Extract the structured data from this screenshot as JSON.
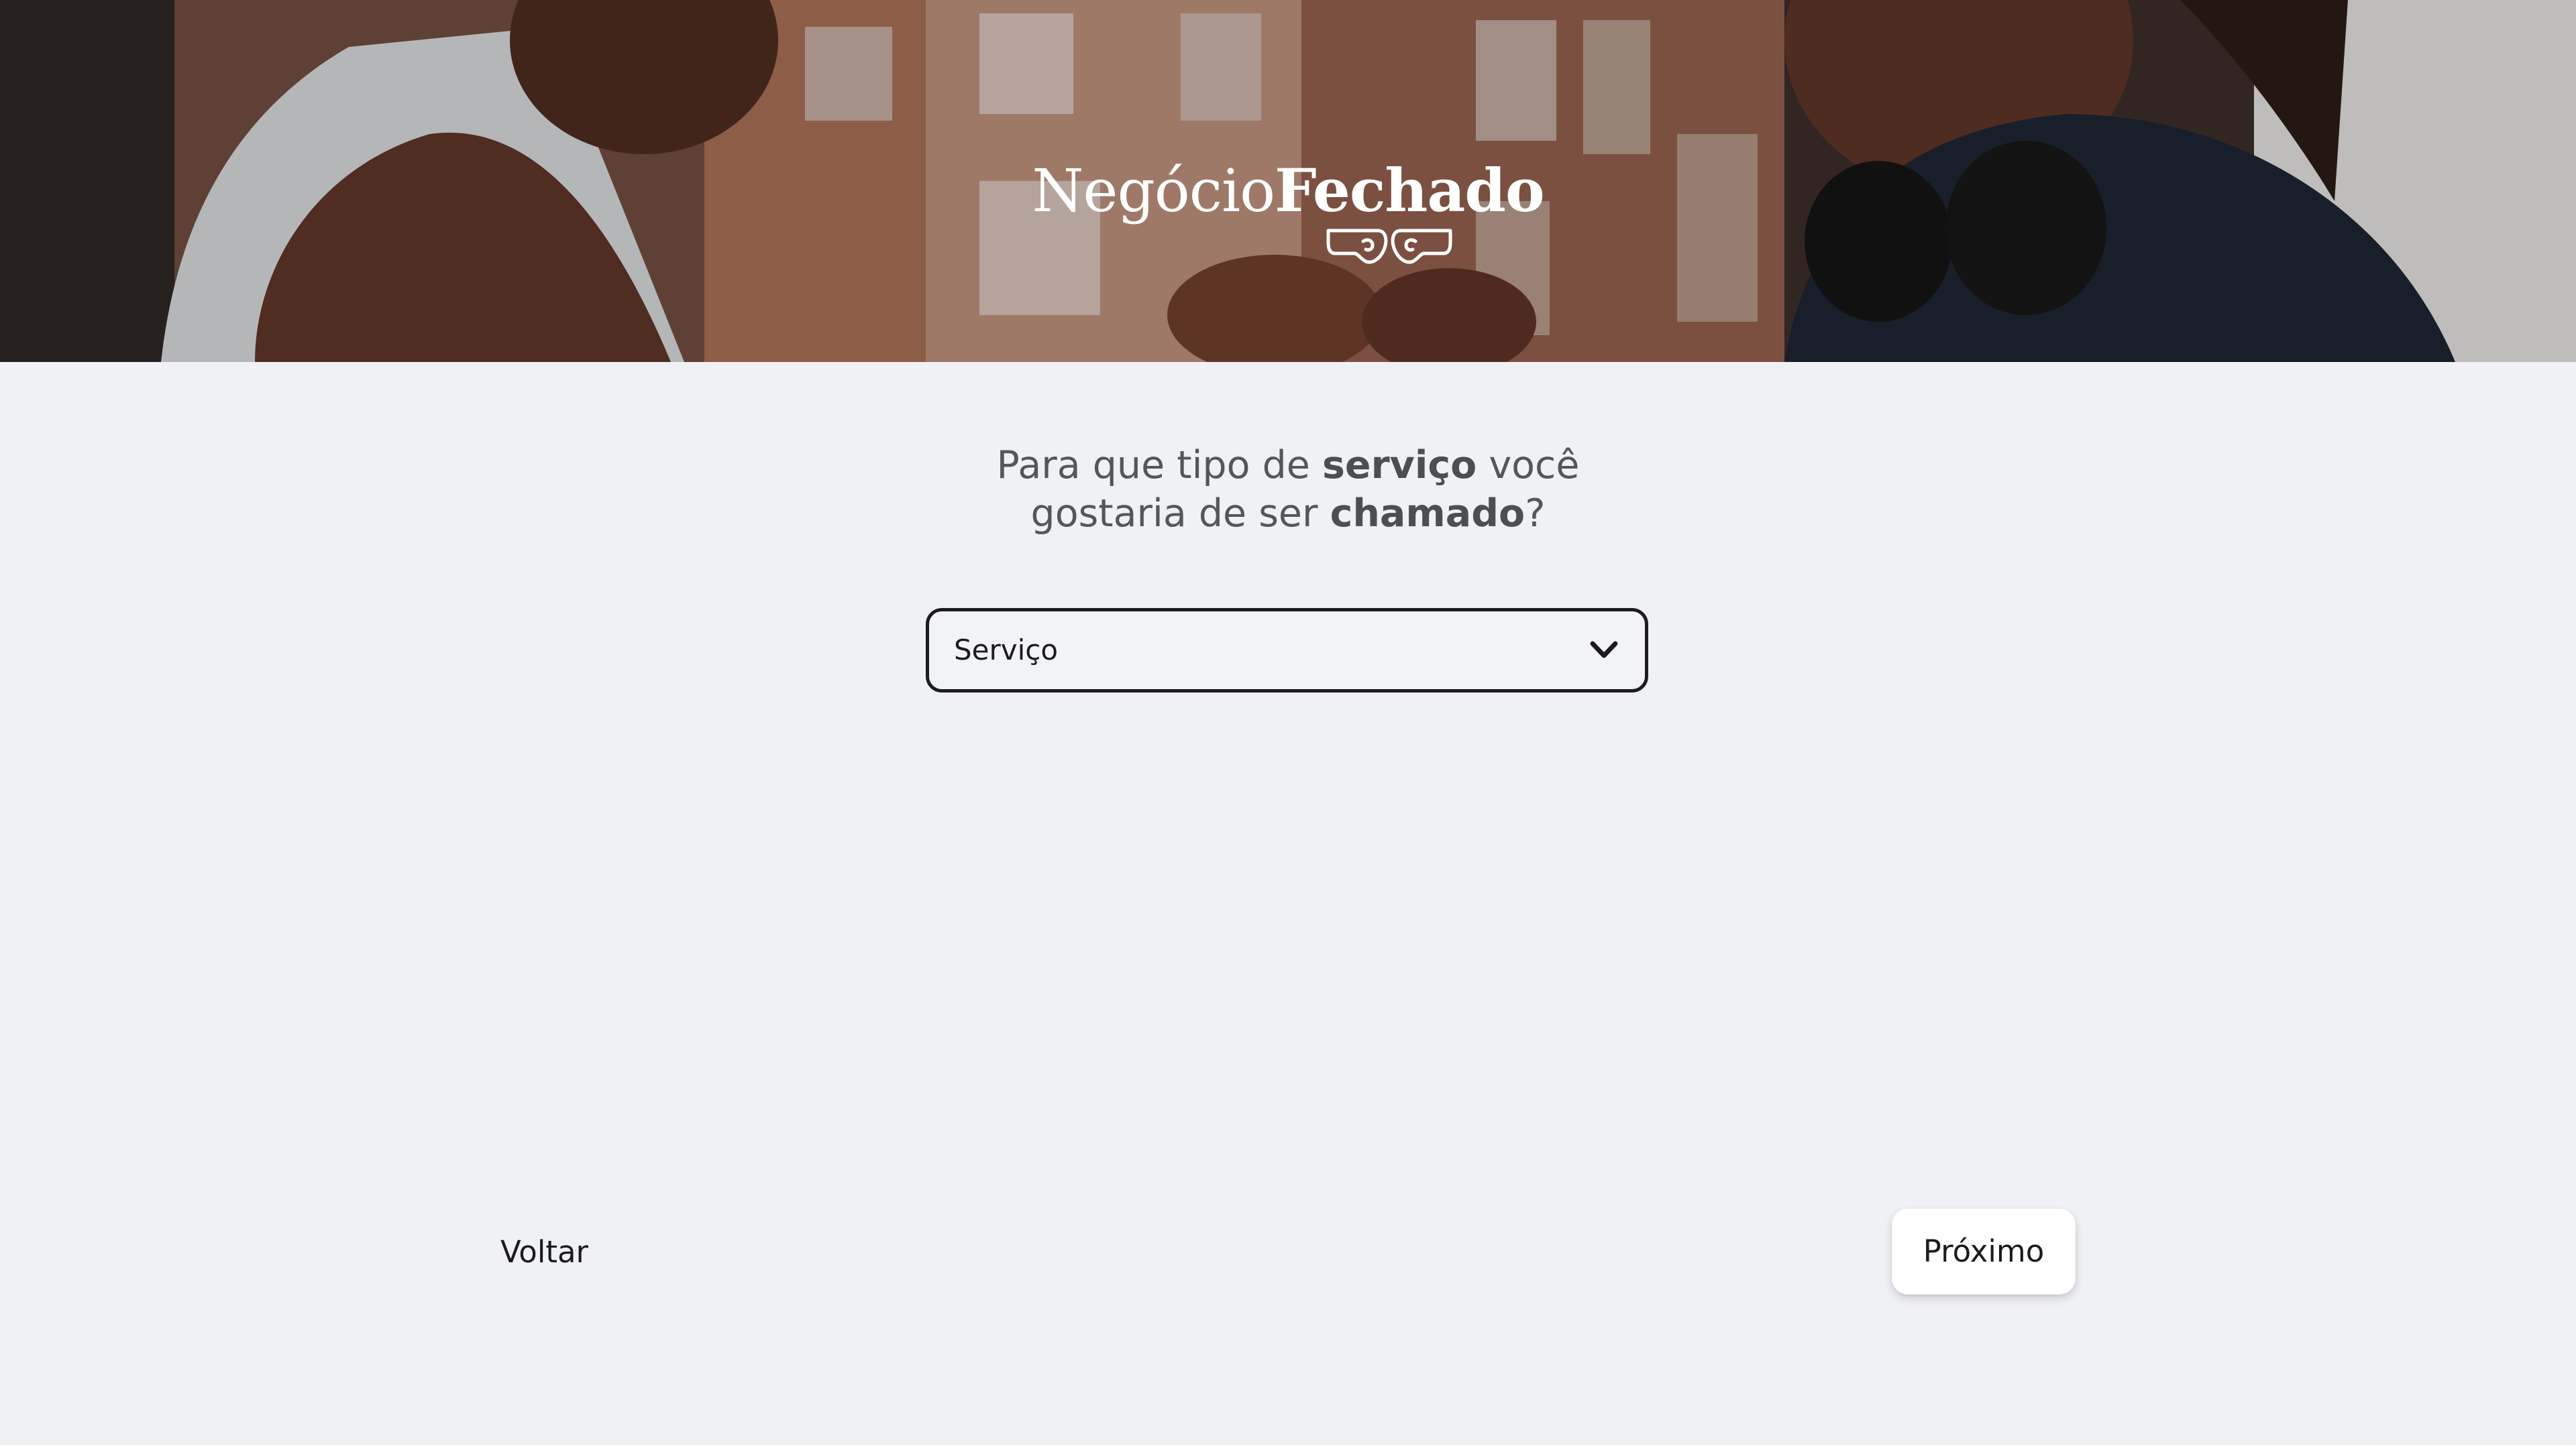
{
  "brand": {
    "name_light": "Negócio",
    "name_bold": "Fechado"
  },
  "hero": {
    "image": "two-people-fist-bump-photo"
  },
  "question": {
    "part1": "Para que tipo de ",
    "bold1": "serviço",
    "part2": " você",
    "part3": "gostaria de ser ",
    "bold2": "chamado",
    "part4": "?"
  },
  "service_select": {
    "selected": "Serviço",
    "icon": "chevron-down-icon"
  },
  "footer": {
    "back_label": "Voltar",
    "next_label": "Próximo"
  },
  "colors": {
    "background": "#f0f1f5",
    "text": "#1b1b1e",
    "question_text": "#55565a",
    "select_border": "#1c1c1f",
    "button_bg": "#ffffff"
  }
}
